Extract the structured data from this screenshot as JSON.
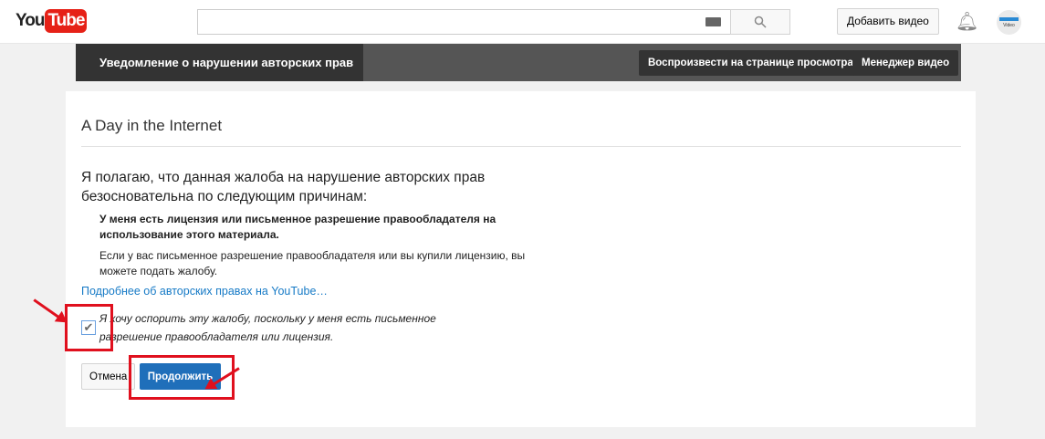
{
  "header": {
    "logo_you": "You",
    "logo_tube": "Tube",
    "search_placeholder": "",
    "upload_label": "Добавить видео",
    "avatar_text": "Video"
  },
  "bar": {
    "title": "Уведомление о нарушении авторских прав",
    "play_label": "Воспроизвести на странице просмотра",
    "manager_label": "Менеджер видео"
  },
  "main": {
    "video_title": "A Day in the Internet",
    "question": "Я полагаю, что данная жалоба на нарушение авторских прав безосновательна по следующим причинам:",
    "reason": "У меня есть лицензия или письменное разрешение правообладателя на использование этого материала.",
    "info": "Если у вас письменное разрешение правообладателя или вы купили лицензию, вы можете подать жалобу.",
    "link": "Подробнее об авторских правах на YouTube…",
    "checkbox_label": "Я хочу оспорить эту жалобу, поскольку у меня есть письменное разрешение правообладателя или лицензия.",
    "checkbox_checked": true,
    "cancel_label": "Отмена",
    "continue_label": "Продолжить"
  }
}
